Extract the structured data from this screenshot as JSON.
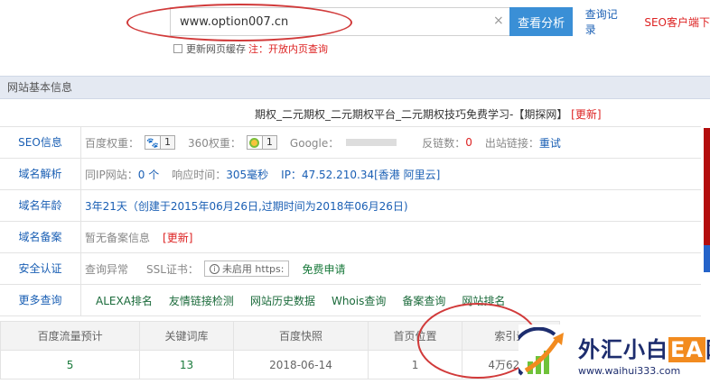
{
  "search": {
    "value": "www.option007.cn",
    "clear_symbol": "×",
    "analyze_label": "查看分析",
    "history_label": "查询记录",
    "seo_label": "SEO客户端下"
  },
  "cache": {
    "checkbox_label": "更新网页缓存",
    "note": "注：开放内页查询"
  },
  "section_title": "网站基本信息",
  "site_title": {
    "text": "期权_二元期权_二元期权平台_二元期权技巧免费学习-【期探网】",
    "update_label": "[更新]"
  },
  "rows": {
    "seo": {
      "label": "SEO信息",
      "baidu_label": "百度权重：",
      "baidu_value": "1",
      "so360_label": "360权重：",
      "so360_value": "1",
      "google_label": "Google：",
      "backlinks_label": "反链数：",
      "backlinks_value": "0",
      "outlinks_label": "出站链接：",
      "outlinks_value": "重试"
    },
    "dns": {
      "label": "域名解析",
      "same_ip_label": "同IP网站：",
      "same_ip_value": "0 个",
      "response_label": "响应时间：",
      "response_value": "305毫秒",
      "ip_label": "IP：",
      "ip_value": "47.52.210.34[香港 阿里云]"
    },
    "age": {
      "label": "域名年龄",
      "value": "3年21天（创建于2015年06月26日,过期时间为2018年06月26日)"
    },
    "icp": {
      "label": "域名备案",
      "value": "暂无备案信息",
      "update_label": "[更新]"
    },
    "security": {
      "label": "安全认证",
      "check_label": "查询异常",
      "ssl_label": "SSL证书：",
      "ssl_badge": "未启用 https:",
      "apply_label": "免费申请"
    },
    "more": {
      "label": "更多查询",
      "links": [
        "ALEXA排名",
        "友情链接检测",
        "网站历史数据",
        "Whois查询",
        "备案查询",
        "网站排名"
      ]
    }
  },
  "stats": {
    "headers": [
      "百度流量预计",
      "关键词库",
      "百度快照",
      "首页位置",
      "索引量"
    ],
    "values": [
      "5",
      "13",
      "2018-06-14",
      "1",
      "4万6274"
    ]
  },
  "watermark": {
    "title_a": "外汇小白",
    "title_b": "EA",
    "title_c": "网",
    "url": "www.waihui333.com"
  },
  "colors": {
    "accent": "#3a8fd6",
    "link": "#1a5fb4",
    "highlight": "#d13a3a",
    "header_bg": "#e4e9f2"
  }
}
